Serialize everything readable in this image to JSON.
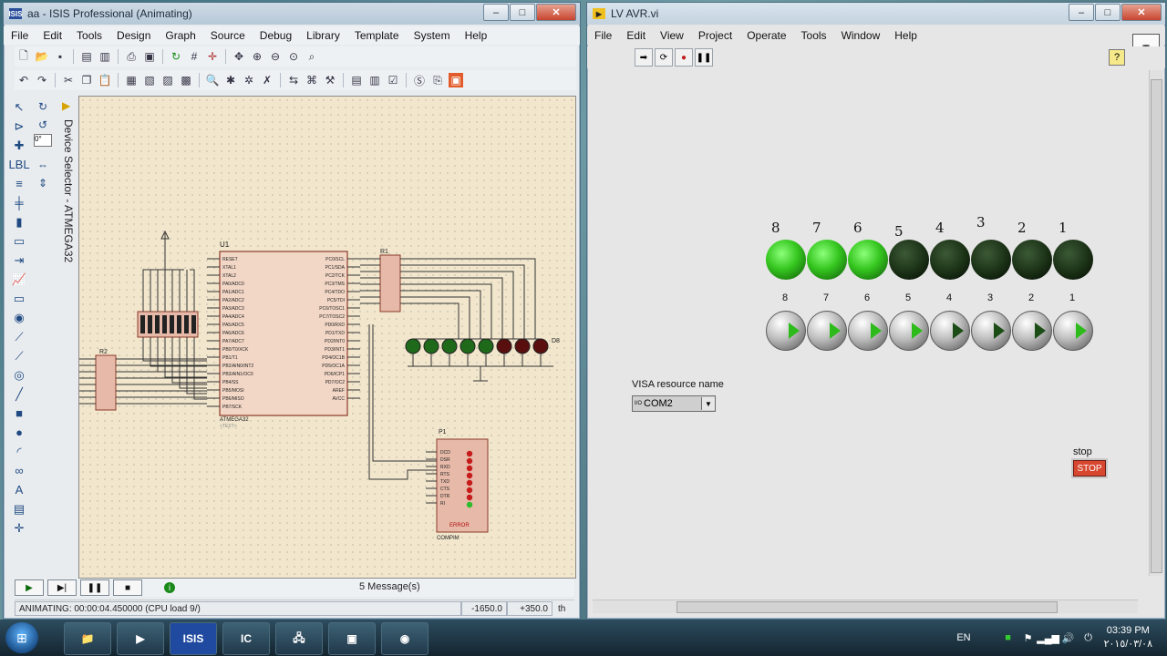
{
  "isis": {
    "title": "aa - ISIS Professional (Animating)",
    "app_icon": "ISIS",
    "menu": [
      "File",
      "Edit",
      "Tools",
      "Design",
      "Graph",
      "Source",
      "Debug",
      "Library",
      "Template",
      "System",
      "Help"
    ],
    "device_selector": "Device Selector - ATMEGA32",
    "zoom_field": "0°",
    "messages": "5 Message(s)",
    "status": "ANIMATING: 00:00:04.450000 (CPU load 9/)",
    "coord_x": "-1650.0",
    "coord_y": "+350.0",
    "coord_unit": "th",
    "schematic": {
      "mcu_ref": "U1",
      "mcu_part": "ATMEGA32",
      "mcu_text": "<TEXT>",
      "mcu_left_pins": [
        "RESET",
        "XTAL1",
        "XTAL2",
        "PA0/ADC0",
        "PA1/ADC1",
        "PA2/ADC2",
        "PA3/ADC3",
        "PA4/ADC4",
        "PA5/ADC5",
        "PA6/ADC6",
        "PA7/ADC7",
        "PB0/T0/XCK",
        "PB1/T1",
        "PB2/AIN0/INT2",
        "PB3/AIN1/OC0",
        "PB4/SS",
        "PB5/MOSI",
        "PB6/MISO",
        "PB7/SCK"
      ],
      "mcu_right_pins": [
        "PC0/SCL",
        "PC1/SDA",
        "PC2/TCK",
        "PC3/TMS",
        "PC4/TDO",
        "PC5/TDI",
        "PC6/TOSC1",
        "PC7/TOSC2",
        "PD0/RXD",
        "PD1/TXD",
        "PD2/INT0",
        "PD3/INT1",
        "PD4/OC1B",
        "PD5/OC1A",
        "PD6/ICP1",
        "PD7/OC2",
        "AREF",
        "AVCC"
      ],
      "r1_ref": "R1",
      "r2_ref": "R2",
      "d8_ref": "D8",
      "p1_ref": "P1",
      "p1_part": "COMPIM",
      "p1_error": "ERROR",
      "p1_pins": [
        "DCD",
        "DSR",
        "RXD",
        "RTS",
        "TXD",
        "CTS",
        "DTR",
        "RI"
      ]
    },
    "sim_buttons": [
      "play-icon",
      "step-icon",
      "pause-icon",
      "stop-icon"
    ]
  },
  "labview": {
    "title": "LV AVR.vi",
    "menu": [
      "File",
      "Edit",
      "View",
      "Project",
      "Operate",
      "Tools",
      "Window",
      "Help"
    ],
    "led_labels": [
      "8",
      "7",
      "6",
      "5",
      "4",
      "3",
      "2",
      "1"
    ],
    "leds_on": [
      true,
      true,
      true,
      false,
      false,
      false,
      false,
      false
    ],
    "button_labels": [
      "8",
      "7",
      "6",
      "5",
      "4",
      "3",
      "2",
      "1"
    ],
    "buttons_on": [
      true,
      true,
      true,
      true,
      false,
      false,
      false,
      true
    ],
    "visa_label": "VISA resource name",
    "visa_prefix": "I/O",
    "visa_value": "COM2",
    "stop_label": "stop",
    "stop_button": "STOP",
    "help": "?"
  },
  "taskbar": {
    "lang": "EN",
    "time": "03:39 PM",
    "date": "٢٠١٥/٠٣/٠٨",
    "apps": [
      "explorer",
      "labview",
      "ISIS",
      "ares",
      "network-tool",
      "device-manager",
      "chrome"
    ]
  }
}
